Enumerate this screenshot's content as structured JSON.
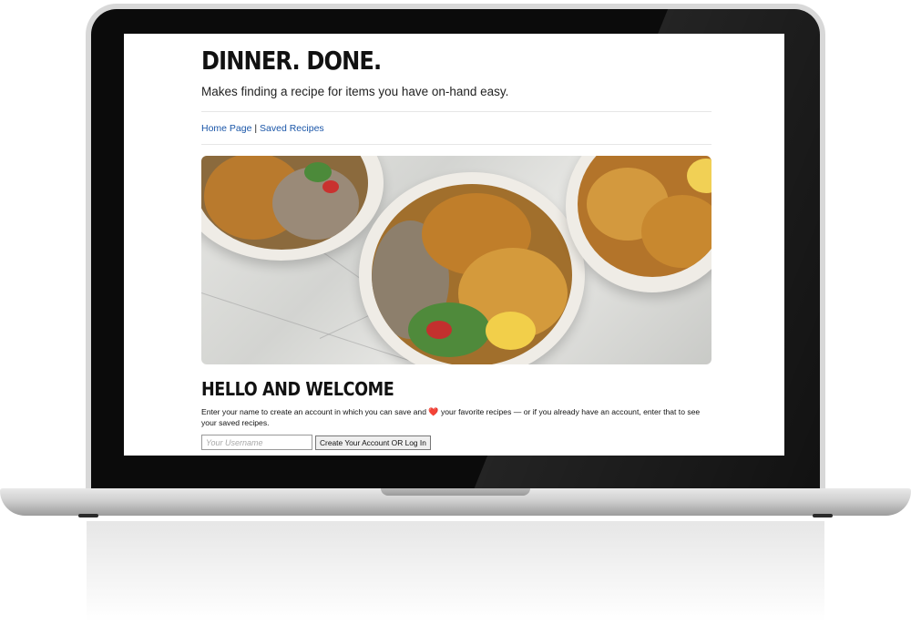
{
  "site": {
    "title": "DINNER. DONE.",
    "tagline": "Makes finding a recipe for items you have on-hand easy."
  },
  "nav": {
    "items": [
      {
        "label": "Home Page"
      },
      {
        "label": "Saved Recipes"
      }
    ],
    "separator": "|"
  },
  "hero": {
    "icon": "food-bowls-photo"
  },
  "welcome": {
    "heading": "HELLO AND WELCOME",
    "intro_before": "Enter your name to create an account in which you can save and",
    "heart_icon": "❤️",
    "intro_after": "your favorite recipes — or if you already have an account, enter that to see your saved recipes."
  },
  "form": {
    "username_placeholder": "Your Username",
    "submit_label": "Create Your Account OR Log In"
  },
  "colors": {
    "link": "#1a56a8",
    "heart": "#d9262b"
  }
}
